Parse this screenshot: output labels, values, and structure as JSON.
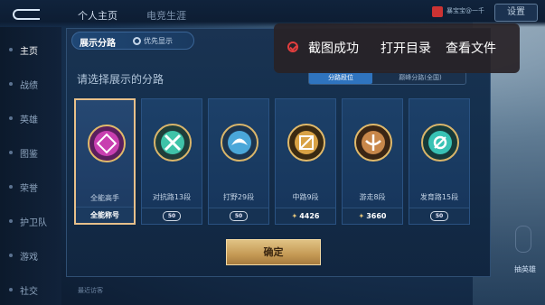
{
  "top_nav": {
    "tabs": [
      {
        "label": "个人主页",
        "active": true
      },
      {
        "label": "电竞生涯",
        "active": false
      }
    ],
    "right_button": "设置",
    "user_snippet": "暴宝宝@一千"
  },
  "sidebar": {
    "items": [
      {
        "label": "主页",
        "active": true
      },
      {
        "label": "战绩",
        "active": false
      },
      {
        "label": "英雄",
        "active": false
      },
      {
        "label": "图鉴",
        "active": false
      },
      {
        "label": "荣誉",
        "active": false
      },
      {
        "label": "护卫队",
        "active": false
      },
      {
        "label": "游戏",
        "active": false
      },
      {
        "label": "社交",
        "active": false
      }
    ]
  },
  "panel": {
    "title": "展示分路",
    "priority_label": "优先显示",
    "prompt": "请选择展示的分路",
    "switch": {
      "left": "分路段位",
      "right": "巅峰分路(全国)"
    },
    "cards": [
      {
        "label": "全能高手",
        "foot": "全能称号",
        "foot_type": "text",
        "color": "#c83fb0",
        "selected": true
      },
      {
        "label": "对抗路13段",
        "foot": "50",
        "foot_type": "badge",
        "color": "#3fc3a8",
        "selected": false
      },
      {
        "label": "打野29段",
        "foot": "50",
        "foot_type": "badge",
        "color": "#4aa7d9",
        "selected": false
      },
      {
        "label": "中路9段",
        "foot": "4426",
        "foot_type": "points",
        "color": "#d8a245",
        "selected": false
      },
      {
        "label": "游走8段",
        "foot": "3660",
        "foot_type": "points",
        "color": "#c8874a",
        "selected": false
      },
      {
        "label": "发育路15段",
        "foot": "50",
        "foot_type": "badge",
        "color": "#38c2b4",
        "selected": false
      }
    ],
    "confirm_label": "确定"
  },
  "toast": {
    "message": "截图成功",
    "open_directory": "打开目录",
    "view_file": "查看文件"
  },
  "bottom": {
    "text": "最近访客"
  },
  "right_side": {
    "label": "抽英雄"
  },
  "colors": {
    "accent_gold": "#e0c284",
    "selected_border": "#e7c08a",
    "toast_success": "#e23e3e"
  }
}
